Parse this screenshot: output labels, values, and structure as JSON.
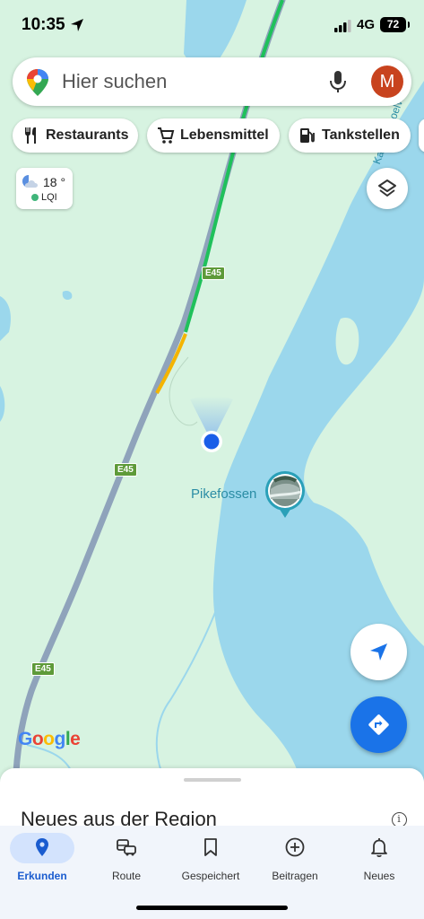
{
  "status_bar": {
    "time": "10:35",
    "network": "4G",
    "battery": "72"
  },
  "search": {
    "placeholder": "Hier suchen",
    "avatar_letter": "M"
  },
  "chips": [
    {
      "label": "Restaurants",
      "icon": "restaurant-icon"
    },
    {
      "label": "Lebensmittel",
      "icon": "shopping-cart-icon"
    },
    {
      "label": "Tankstellen",
      "icon": "gas-station-icon"
    }
  ],
  "weather": {
    "temperature": "18 °",
    "air_quality": "LQI"
  },
  "map": {
    "road_labels": [
      "E45",
      "E45",
      "E45"
    ],
    "poi_name": "Pikefossen",
    "river_label": "Kautokeinoelva",
    "logo": "Google"
  },
  "sheet": {
    "title": "Neues aus der Region"
  },
  "nav": [
    {
      "label": "Erkunden",
      "active": true
    },
    {
      "label": "Route",
      "active": false
    },
    {
      "label": "Gespeichert",
      "active": false
    },
    {
      "label": "Beitragen",
      "active": false
    },
    {
      "label": "Neues",
      "active": false
    }
  ],
  "colors": {
    "land": "#d7f3e1",
    "water": "#9bd7ec",
    "accent": "#1a73e8",
    "road": "#8fa3bb",
    "traffic_green": "#1fc15b",
    "traffic_yellow": "#f4b400"
  }
}
